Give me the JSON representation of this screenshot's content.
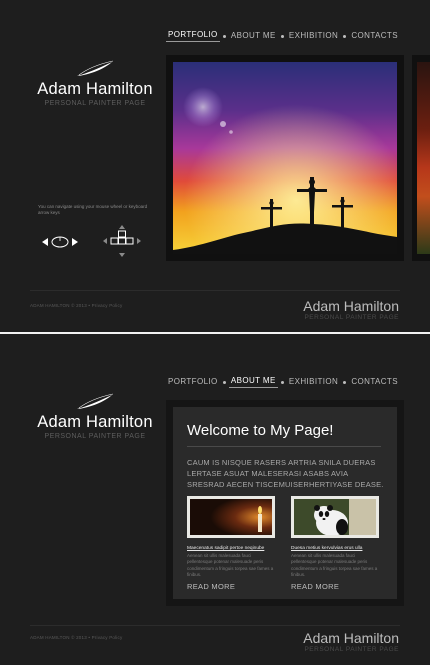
{
  "nav": {
    "items": [
      {
        "label": "PORTFOLIO"
      },
      {
        "label": "ABOUT ME"
      },
      {
        "label": "EXHIBITION"
      },
      {
        "label": "CONTACTS"
      }
    ]
  },
  "brand": {
    "name": "Adam Hamilton",
    "tagline": "PERSONAL PAINTER PAGE"
  },
  "portfolio": {
    "hint": "You can navigate using your mouse wheel or keyboard arrow keys"
  },
  "footer": {
    "copyright": "ADAM HAMILTON © 2013 • Privacy Policy",
    "name": "Adam Hamilton",
    "tagline": "PERSONAL PAINTER PAGE"
  },
  "about": {
    "title": "Welcome to My Page!",
    "intro": "CAUM IS NISQUE RASERS ARTRIA SNILA DUERAS LERTASE ASUAT MALESERASI ASABS AVIA SRESRAD AECEN TISCEMUISERHERTIYASE DEASE.",
    "cards": [
      {
        "title": "Maecenatus sadipit pertoe neqinube",
        "body": "Aenean sit ullis malesuada fauci pellentesque potenar malesuade peris condimentum a fringuis torpea sae fames a finibus.",
        "more": "READ MORE"
      },
      {
        "title": "Duesa metius kervulvias erus ulla",
        "body": "Aenean sit ullis malesuada fauci pellentesque potenar malesuade peris condimentum a fringuis torpea sae fames a finibus.",
        "more": "READ MORE"
      }
    ]
  }
}
